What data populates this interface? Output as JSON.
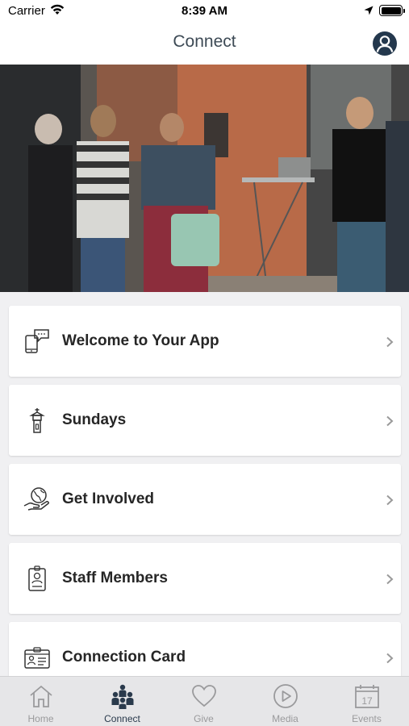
{
  "status_bar": {
    "carrier": "Carrier",
    "time": "8:39 AM"
  },
  "header": {
    "title": "Connect",
    "profile_icon": "person-circle-icon"
  },
  "hero_image": {
    "description_icon": "photo"
  },
  "menu": {
    "items": [
      {
        "label": "Welcome to Your App",
        "icon": "phone-chat-icon"
      },
      {
        "label": "Sundays",
        "icon": "steeple-icon"
      },
      {
        "label": "Get Involved",
        "icon": "globe-hand-icon"
      },
      {
        "label": "Staff Members",
        "icon": "id-badge-icon"
      },
      {
        "label": "Connection Card",
        "icon": "id-card-icon"
      }
    ]
  },
  "tab_bar": {
    "active": "Connect",
    "tabs": [
      {
        "label": "Home",
        "icon": "home-icon"
      },
      {
        "label": "Connect",
        "icon": "people-icon"
      },
      {
        "label": "Give",
        "icon": "heart-icon"
      },
      {
        "label": "Media",
        "icon": "play-circle-icon"
      },
      {
        "label": "Events",
        "icon": "calendar-icon",
        "calendar_day": "17"
      }
    ]
  },
  "colors": {
    "nav_title": "#3d4a55",
    "active_tab": "#2a3a4c",
    "inactive_tab": "#9a9a9c",
    "profile_bg": "#24384d"
  }
}
